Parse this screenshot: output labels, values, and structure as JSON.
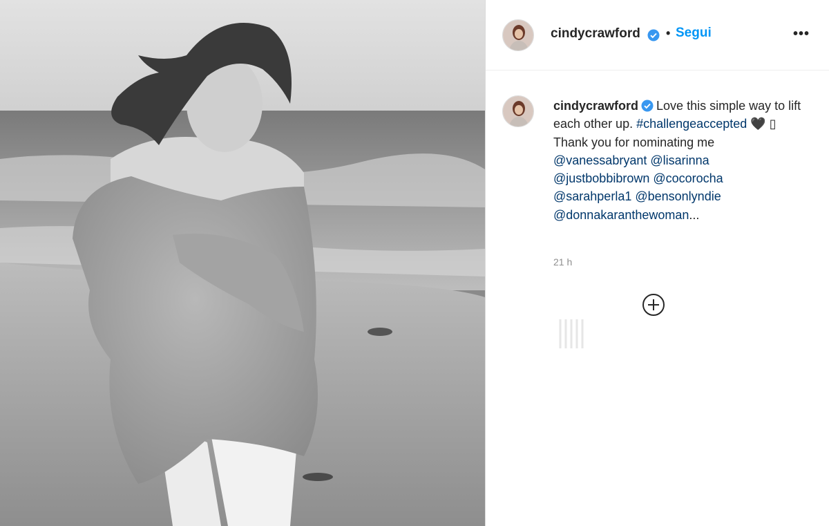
{
  "post": {
    "image_alt": "black and white beach photo",
    "image_style": "black-and-white"
  },
  "header": {
    "username": "cindycrawford",
    "separator": "•",
    "follow_label": "Segui",
    "more_label": "•••"
  },
  "comment": {
    "username": "cindycrawford",
    "caption_text_1": "Love this simple way to lift each other up.",
    "hashtag": "#challengeaccepted",
    "heart": "🖤",
    "emoji_box": "▯",
    "caption_text_2": "Thank you for nominating me",
    "mentions": [
      "@vanessabryant",
      "@lisarinna",
      "@justbobbibrown",
      "@cocorocha",
      "@sarahperla1",
      "@benson​lyndie",
      "@donnakaranthewoman"
    ],
    "ellipsis": "...",
    "timestamp": "21 h"
  },
  "icons": {
    "verified": "verified-badge-icon",
    "load_more": "plus-circle-icon",
    "loading": "loading-spinner-icon",
    "more": "more-options-icon"
  },
  "colors": {
    "link_blue": "#0095f6",
    "verified_blue": "#3897f0",
    "mention_blue": "#00376b",
    "text": "#262626",
    "muted": "#8e8e8e"
  }
}
